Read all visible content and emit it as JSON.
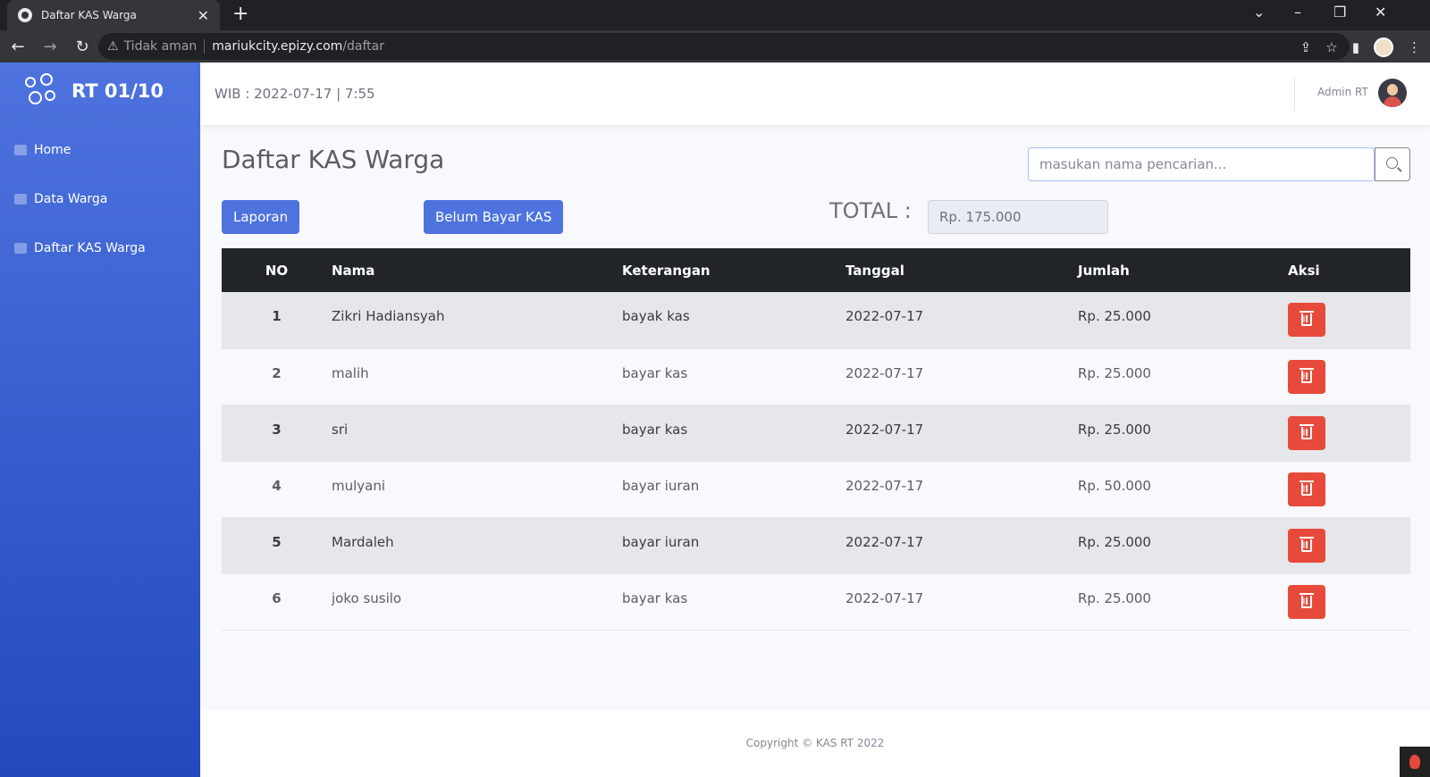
{
  "browser": {
    "tab_title": "Daftar KAS Warga",
    "security_label": "Tidak aman",
    "url_host": "mariukcity.epizy.com",
    "url_path": "/daftar"
  },
  "sidebar": {
    "brand": "RT 01/10",
    "items": [
      {
        "label": "Home",
        "icon": "home-icon"
      },
      {
        "label": "Data Warga",
        "icon": "users-icon"
      },
      {
        "label": "Daftar KAS Warga",
        "icon": "table-icon"
      }
    ]
  },
  "topbar": {
    "clock": "WIB : 2022-07-17 | 7:55",
    "admin_name": "Admin RT"
  },
  "main": {
    "title": "Daftar KAS Warga",
    "search_placeholder": "masukan nama pencarian...",
    "btn_laporan": "Laporan",
    "btn_belum_bayar": "Belum Bayar KAS",
    "total_label": "TOTAL :",
    "total_value": "Rp. 175.000"
  },
  "table": {
    "headers": [
      "NO",
      "Nama",
      "Keterangan",
      "Tanggal",
      "Jumlah",
      "Aksi"
    ],
    "rows": [
      {
        "no": "1",
        "nama": "Zikri Hadiansyah",
        "keterangan": "bayak kas",
        "tanggal": "2022-07-17",
        "jumlah": "Rp. 25.000"
      },
      {
        "no": "2",
        "nama": "malih",
        "keterangan": "bayar kas",
        "tanggal": "2022-07-17",
        "jumlah": "Rp. 25.000"
      },
      {
        "no": "3",
        "nama": "sri",
        "keterangan": "bayar kas",
        "tanggal": "2022-07-17",
        "jumlah": "Rp. 25.000"
      },
      {
        "no": "4",
        "nama": "mulyani",
        "keterangan": "bayar iuran",
        "tanggal": "2022-07-17",
        "jumlah": "Rp. 50.000"
      },
      {
        "no": "5",
        "nama": "Mardaleh",
        "keterangan": "bayar iuran",
        "tanggal": "2022-07-17",
        "jumlah": "Rp. 25.000"
      },
      {
        "no": "6",
        "nama": "joko susilo",
        "keterangan": "bayar kas",
        "tanggal": "2022-07-17",
        "jumlah": "Rp. 25.000"
      }
    ]
  },
  "footer": {
    "copyright": "Copyright © KAS RT 2022"
  },
  "colors": {
    "primary": "#4e73df",
    "danger": "#e74a3b",
    "table_header": "#212529"
  }
}
